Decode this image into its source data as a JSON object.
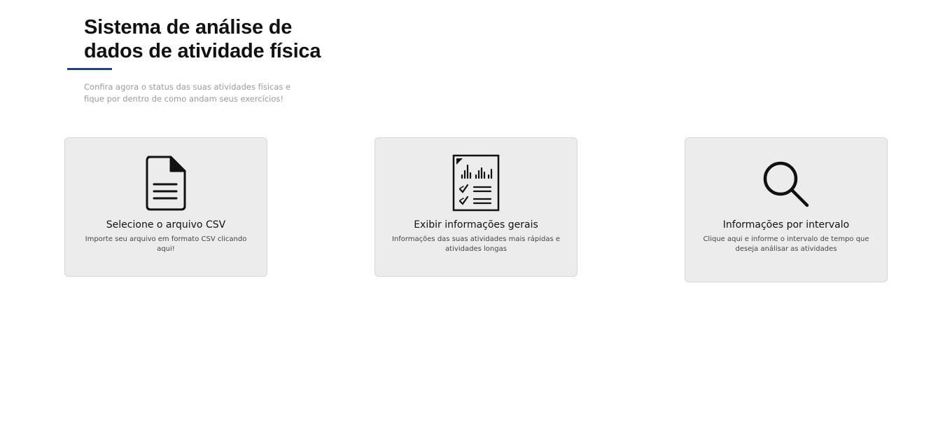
{
  "header": {
    "title": "Sistema de análise de dados de atividade física",
    "subtitle": "Confira agora o status das suas atividades físicas e fique por dentro de como andam seus exercícios!"
  },
  "cards": [
    {
      "icon": "document-icon",
      "title": "Selecione o arquivo CSV",
      "description": "Importe seu arquivo em formato CSV clicando aqui!"
    },
    {
      "icon": "report-chart-icon",
      "title": "Exibir informações gerais",
      "description": "Informações das suas atividades mais rápidas e atividades longas"
    },
    {
      "icon": "search-icon",
      "title": "Informações por intervalo",
      "description": "Clique aqui e informe o intervalo de tempo que deseja análisar as atividades"
    }
  ],
  "colors": {
    "accent": "#1f3f94",
    "card_background": "#ececec",
    "subtitle_text": "#9a9a9a"
  }
}
